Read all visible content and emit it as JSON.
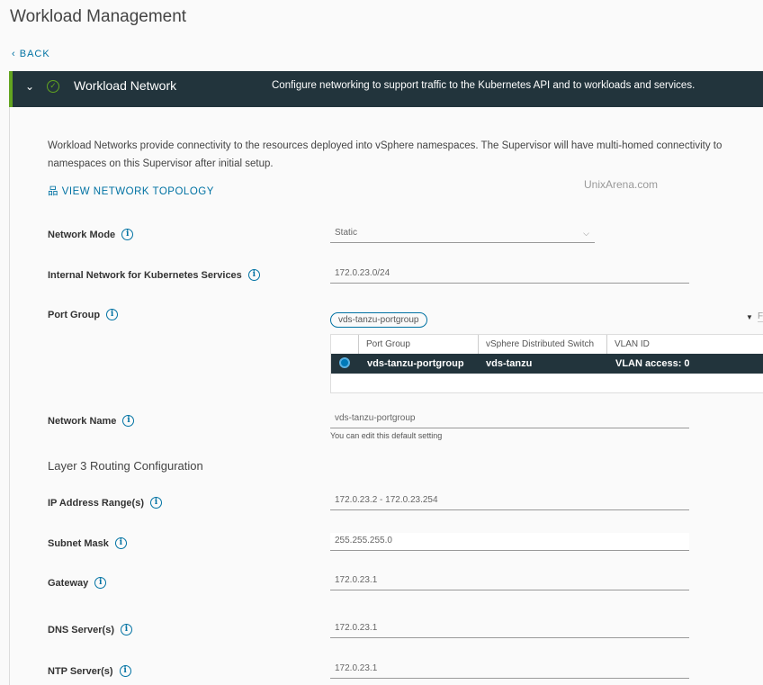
{
  "page": {
    "title": "Workload Management",
    "back_label": "BACK"
  },
  "section": {
    "title": "Workload Network",
    "description": "Configure networking to support traffic to the Kubernetes API and to workloads and services."
  },
  "intro": {
    "line1": "Workload Networks provide connectivity to the resources deployed into vSphere namespaces. The Supervisor will have multi-homed connectivity to",
    "line2": "namespaces on this Supervisor after initial setup.",
    "topology_link": "VIEW NETWORK TOPOLOGY",
    "watermark": "UnixArena.com"
  },
  "form": {
    "network_mode": {
      "label": "Network Mode",
      "value": "Static"
    },
    "internal_network": {
      "label": "Internal Network for Kubernetes Services",
      "value": "172.0.23.0/24"
    },
    "port_group": {
      "label": "Port Group",
      "selected_pill": "vds-tanzu-portgroup",
      "filter_placeholder": "Filter",
      "columns": [
        "Port Group",
        "vSphere Distributed Switch",
        "VLAN ID"
      ],
      "rows": [
        {
          "port_group": "vds-tanzu-portgroup",
          "switch": "vds-tanzu",
          "vlan": "VLAN access: 0",
          "selected": true
        }
      ]
    },
    "network_name": {
      "label": "Network Name",
      "value": "vds-tanzu-portgroup",
      "hint": "You can edit this default setting"
    },
    "l3_heading": "Layer 3 Routing Configuration",
    "ip_range": {
      "label": "IP Address Range(s)",
      "value": "172.0.23.2 - 172.0.23.254"
    },
    "subnet": {
      "label": "Subnet Mask",
      "value": "255.255.255.0"
    },
    "gateway": {
      "label": "Gateway",
      "value": "172.0.23.1"
    },
    "dns": {
      "label": "DNS Server(s)",
      "value": "172.0.23.1"
    },
    "ntp": {
      "label": "NTP Server(s)",
      "value": "172.0.23.1"
    }
  },
  "colors": {
    "header_bg": "#22343c",
    "accent": "#0072a3",
    "success": "#62a420"
  }
}
